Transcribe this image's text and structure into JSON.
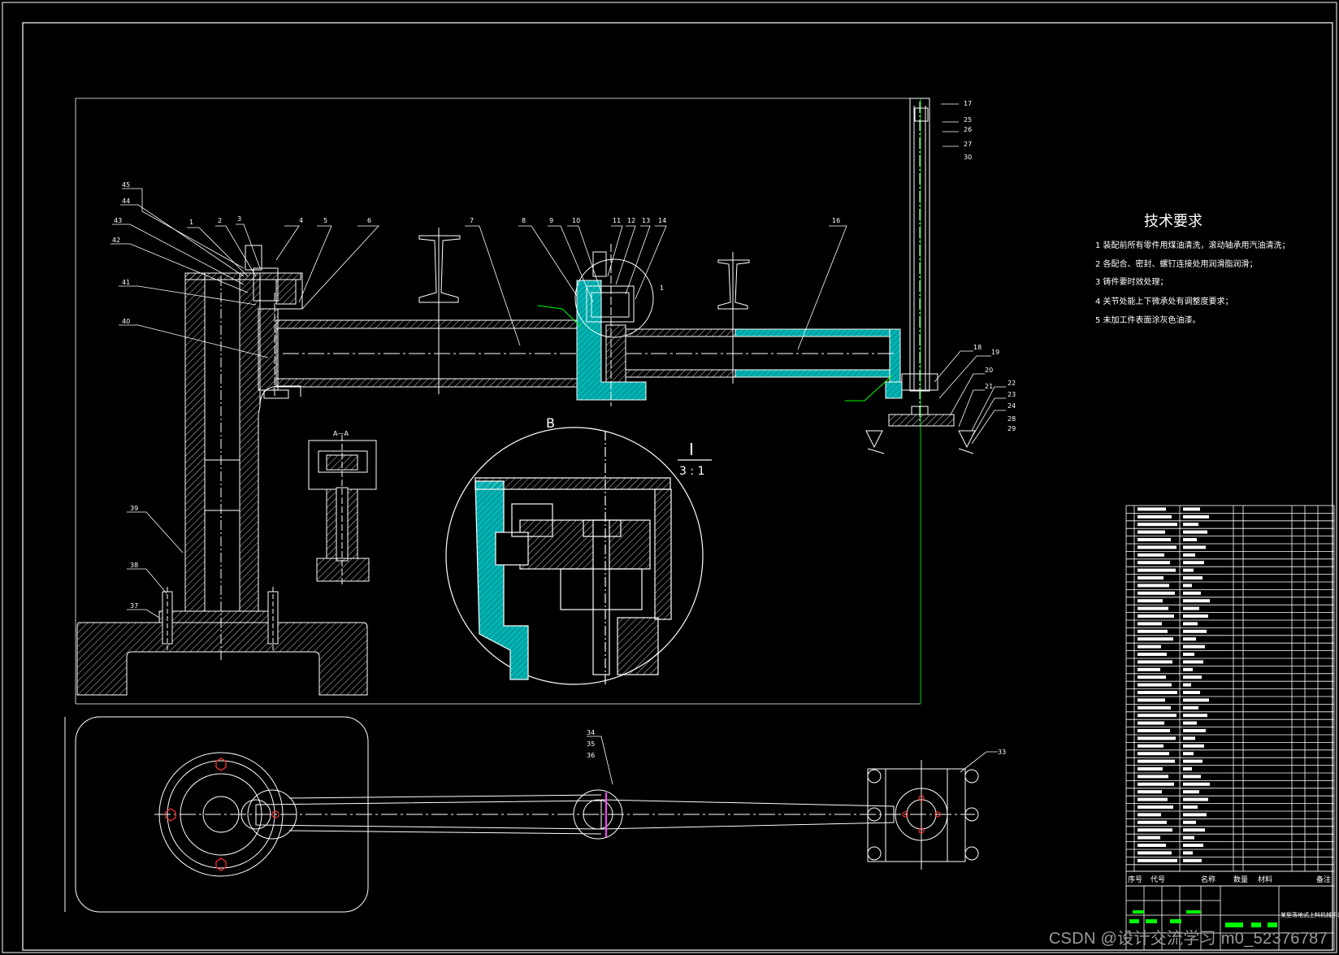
{
  "title": {
    "tech_requirements": "技术要求",
    "section_aa": "A—A",
    "detail_b": "B",
    "detail_i": "I",
    "scale": "3 : 1"
  },
  "requirements": [
    "1 装配前所有零件用煤油清洗，滚动轴承用汽油清洗；",
    "2 各配合、密封、螺钉连接处用润滑脂润滑；",
    "3 铸件要时效处理；",
    "4 关节处能上下微承处有调整度要求；",
    "5 未加工件表面涂灰色油漆。"
  ],
  "callouts": {
    "top": [
      "1",
      "2",
      "3",
      "4",
      "5",
      "6",
      "7",
      "8",
      "9",
      "10",
      "11",
      "12",
      "13",
      "14",
      "1",
      "16",
      "17"
    ],
    "left": [
      "45",
      "44",
      "43",
      "42",
      "41",
      "40",
      "39",
      "38",
      "37"
    ],
    "right": [
      "18",
      "19",
      "20",
      "21",
      "22",
      "23",
      "24",
      "25",
      "26",
      "27",
      "28",
      "29",
      "30"
    ],
    "plan": [
      "34",
      "35",
      "36",
      "33"
    ]
  },
  "bom_header": {
    "no": "序号",
    "code": "代号",
    "name": "名称",
    "qty": "数量",
    "material": "材料",
    "remark": "备注"
  },
  "title_block_name": "某型落地式上料机械手装配图",
  "watermark": "CSDN @设计交流学习 m0_52376787",
  "colors": {
    "line": "#ffffff",
    "hatch": "#00c8c8",
    "leader": "#00ff00",
    "red": "#ff3333",
    "magenta": "#ff44ff",
    "green": "#00ff00"
  }
}
